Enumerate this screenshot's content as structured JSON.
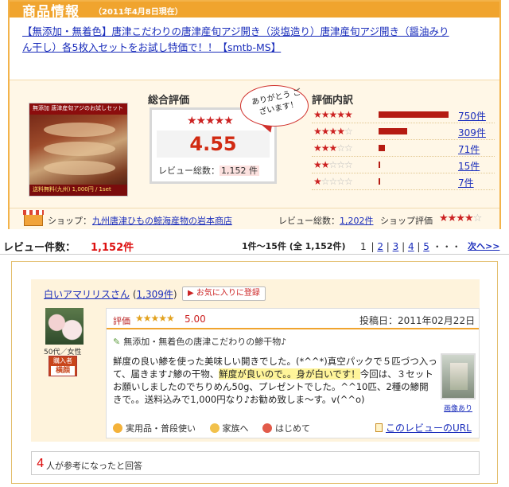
{
  "info": {
    "title": "商品情報",
    "date": "（2011年4月8日現在）",
    "product_link": "【無添加・無着色】唐津こだわりの唐津産旬アジ開き（淡塩造り）唐津産旬アジ開き（醤油みりん干し）各5枚入セットをお試し特価で！！【smtb-MS】",
    "image": {
      "line1": "無添加 唐津産旬アジのお試しセット",
      "line2": "送料無料(九州) 1,000円 / 1set"
    },
    "summary": {
      "label": "総合評価",
      "stars": "★★★★★",
      "score": "4.55",
      "count_label": "レビュー総数：",
      "count_value": "1,152 件"
    },
    "bubble": "ありがとう ございます！",
    "breakdown": {
      "label": "評価内訳",
      "rows": [
        {
          "stars": "★★★★★",
          "empty": "",
          "count": "750件",
          "value": 750
        },
        {
          "stars": "★★★★",
          "empty": "☆",
          "count": "309件",
          "value": 309
        },
        {
          "stars": "★★★",
          "empty": "☆☆",
          "count": "71件",
          "value": 71
        },
        {
          "stars": "★★",
          "empty": "☆☆☆",
          "count": "15件",
          "value": 15
        },
        {
          "stars": "★",
          "empty": "☆☆☆☆",
          "count": "7件",
          "value": 7
        }
      ]
    },
    "shop": {
      "label": "ショップ：",
      "name": "九州唐津ひもの鯨海産物の岩本商店",
      "review_label": "レビュー総数：",
      "review_count": "1,202件",
      "eval_label": "ショップ評価",
      "stars": "★★★★",
      "empty": "☆"
    }
  },
  "list": {
    "label": "レビュー件数：",
    "count": "1,152件",
    "range": "1件〜15件 (全 1,152件)",
    "current_page": "1",
    "pages": [
      "2",
      "3",
      "4",
      "5"
    ],
    "ellipsis": "・・・",
    "next": "次へ>>"
  },
  "review": {
    "user": "白いアマリリスさん",
    "user_count": "1,309件",
    "fav_button": "お気に入りに登録",
    "demographic": "50代／女性",
    "buyer_top": "購入者",
    "buyer_bottom": "横顔",
    "rating_label": "評価",
    "stars": "★★★★★",
    "score": "5.00",
    "date": "投稿日：2011年02月22日",
    "title": "無添加・無着色の唐津こだわりの鯵干物♪",
    "text_a": "鮮度の良い鯵を使った美味しい開きでした。(*^^*)真空パックで５匹づつ入って、届きます♪鯵の干物、",
    "text_hl": "鮮度が良いので。。身が白いです！",
    "text_b": "今回は、３セットお願いしましたのでちりめん50g、プレゼントでした。^^10匹、2種の鯵開きで。。送料込みで1,000円なり♪お勧め致しま〜す。v(^^o)",
    "photo_label": "画像あり",
    "tags": [
      "実用品・普段使い",
      "家族へ",
      "はじめて"
    ],
    "url_link": "このレビューのURL",
    "helpful_count": "4",
    "helpful_text": "人が参考になったと回答"
  }
}
